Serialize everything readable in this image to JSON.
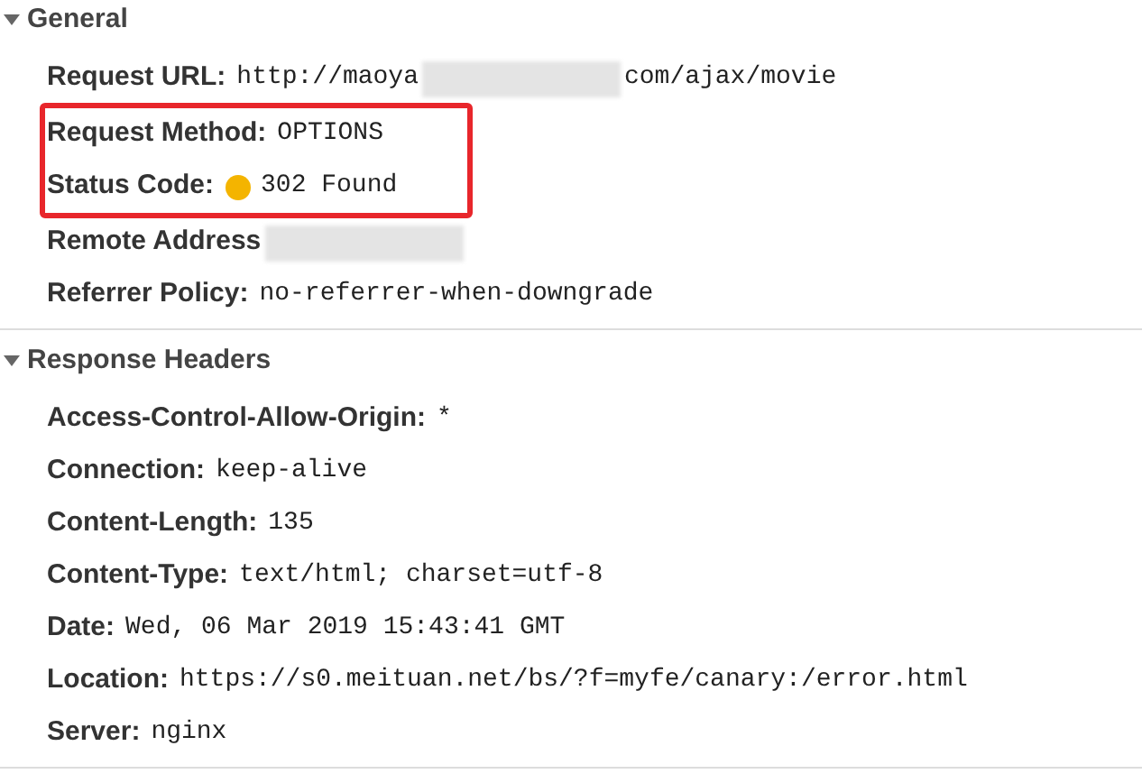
{
  "sections": [
    {
      "title": "General",
      "expanded": true,
      "rows": [
        {
          "label": "Request URL:",
          "value": "http://maoya",
          "redacted": true,
          "value_after": "com/ajax/movie",
          "highlighted": false
        },
        {
          "label": "Request Method:",
          "value": "OPTIONS",
          "highlighted": true
        },
        {
          "label": "Status Code:",
          "value": "302 Found",
          "color": "#f4b400",
          "highlighted": true
        },
        {
          "label": "Remote Address",
          "redacted": true,
          "highlighted": false
        },
        {
          "label": "Referrer Policy:",
          "value": "no-referrer-when-downgrade",
          "highlighted": false
        }
      ]
    },
    {
      "title": "Response Headers",
      "expanded": true,
      "rows": [
        {
          "label": "Access-Control-Allow-Origin:",
          "value": "*",
          "highlighted": false
        },
        {
          "label": "Connection:",
          "value": "keep-alive",
          "highlighted": false
        },
        {
          "label": "Content-Length:",
          "value": "135",
          "highlighted": false
        },
        {
          "label": "Content-Type:",
          "value": "text/html; charset=utf-8",
          "highlighted": false
        },
        {
          "label": "Date:",
          "value": "Wed, 06 Mar 2019 15:43:41 GMT",
          "highlighted": false
        },
        {
          "label": "Location:",
          "value": "https://s0.meituan.net/bs/?f=myfe/canary:/error.html",
          "highlighted": false
        },
        {
          "label": "Server:",
          "value": "nginx",
          "highlighted": false
        }
      ]
    }
  ]
}
